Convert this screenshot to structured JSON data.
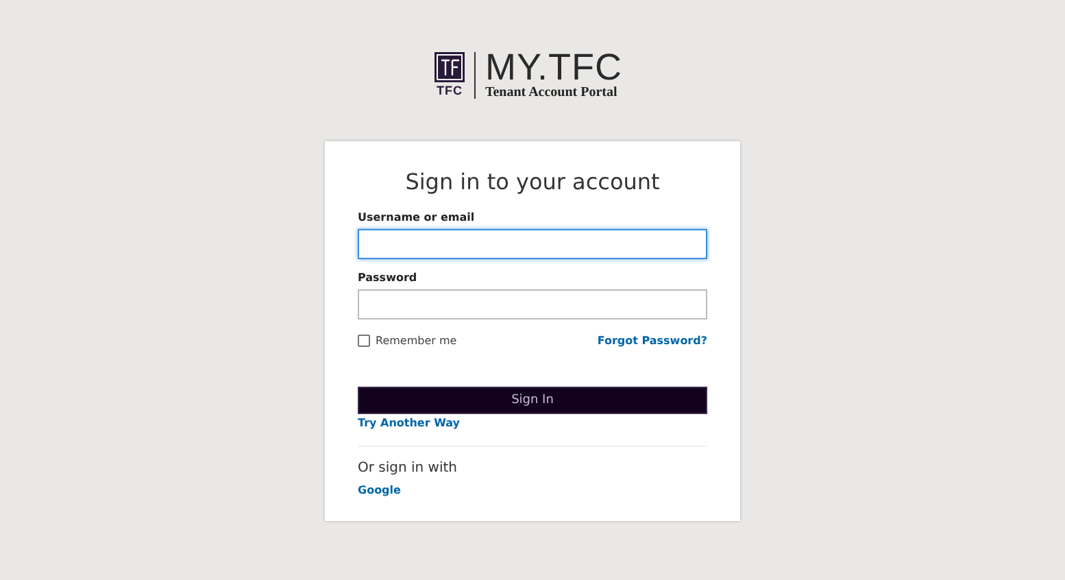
{
  "logo": {
    "mark_caption": "TFC",
    "title": "MY.TFC",
    "subtitle": "Tenant Account Portal"
  },
  "form": {
    "heading": "Sign in to your account",
    "fields": [
      {
        "label": "Username or email",
        "focused": true
      },
      {
        "label": "Password",
        "focused": false
      }
    ],
    "remember": {
      "label": "Remember me",
      "checked": false
    },
    "forgot_link": "Forgot Password?",
    "submit": "Sign In",
    "alt_link": "Try Another Way",
    "social_heading": "Or sign in with",
    "providers": [
      "Google"
    ]
  }
}
